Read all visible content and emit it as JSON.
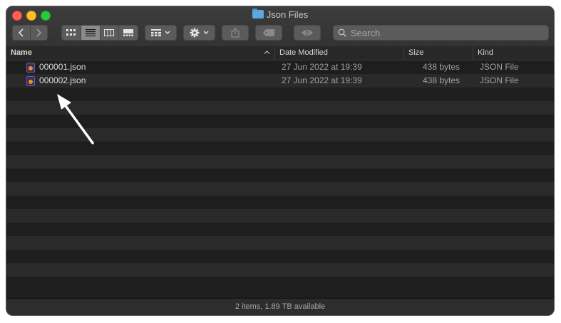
{
  "window": {
    "title": "Json Files",
    "folder_icon": "folder-icon"
  },
  "toolbar": {
    "back_icon": "‹",
    "forward_icon": "›",
    "view_modes": [
      "icon-view",
      "list-view",
      "column-view",
      "gallery-view"
    ],
    "active_view": "list-view",
    "group_icon": "group-by-icon",
    "action_icon": "gear-icon",
    "share_icon": "share-icon",
    "tag_icon": "tag-icon",
    "quicklook_icon": "eye-icon"
  },
  "search": {
    "placeholder": "Search"
  },
  "columns": {
    "name": "Name",
    "date_modified": "Date Modified",
    "size": "Size",
    "kind": "Kind"
  },
  "files": [
    {
      "name": "000001.json",
      "date_modified": "27 Jun 2022 at 19:39",
      "size": "438 bytes",
      "kind": "JSON File"
    },
    {
      "name": "000002.json",
      "date_modified": "27 Jun 2022 at 19:39",
      "size": "438 bytes",
      "kind": "JSON File"
    }
  ],
  "status": {
    "text": "2 items, 1.89 TB available"
  },
  "colors": {
    "window_bg": "#1e1e1e",
    "row_alt": "#2a2a2a",
    "close": "#fe5f57",
    "minimize": "#febc2e",
    "maximize": "#28c840"
  }
}
